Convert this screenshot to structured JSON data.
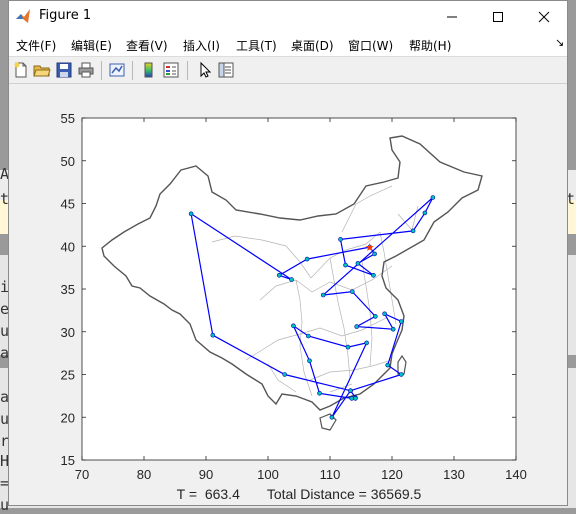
{
  "window": {
    "title": "Figure 1"
  },
  "menu": {
    "items": [
      "文件(F)",
      "编辑(E)",
      "查看(V)",
      "插入(I)",
      "工具(T)",
      "桌面(D)",
      "窗口(W)",
      "帮助(H)"
    ]
  },
  "background_text": [
    "AV",
    "ta",
    "i",
    "e",
    "u",
    "a",
    "a",
    "u",
    "r",
    "H",
    "=",
    "u",
    "tc"
  ],
  "plot": {
    "xlim": [
      70,
      140
    ],
    "ylim": [
      15,
      55
    ],
    "xticks": [
      "70",
      "80",
      "90",
      "100",
      "110",
      "120",
      "130",
      "140"
    ],
    "yticks": [
      "15",
      "20",
      "25",
      "30",
      "35",
      "40",
      "45",
      "50",
      "55"
    ],
    "route_color": "#0000ff",
    "node_color": "#00c0c0",
    "start_color": "#ff3300",
    "start": [
      116.4,
      39.9
    ],
    "route": [
      [
        116.4,
        39.9
      ],
      [
        117.2,
        39.1
      ],
      [
        114.5,
        38.0
      ],
      [
        117.0,
        36.6
      ],
      [
        112.5,
        37.8
      ],
      [
        111.7,
        40.8
      ],
      [
        123.4,
        41.8
      ],
      [
        125.3,
        43.9
      ],
      [
        126.6,
        45.7
      ],
      [
        108.9,
        34.3
      ],
      [
        113.6,
        34.7
      ],
      [
        117.3,
        31.8
      ],
      [
        114.3,
        30.6
      ],
      [
        120.2,
        30.3
      ],
      [
        118.8,
        32.1
      ],
      [
        121.5,
        31.2
      ],
      [
        119.3,
        26.1
      ],
      [
        121.5,
        25.0
      ],
      [
        113.3,
        23.1
      ],
      [
        114.1,
        22.3
      ],
      [
        114.1,
        22.2
      ],
      [
        113.5,
        22.2
      ],
      [
        108.3,
        22.8
      ],
      [
        106.7,
        26.6
      ],
      [
        104.1,
        30.7
      ],
      [
        106.5,
        29.5
      ],
      [
        112.9,
        28.2
      ],
      [
        115.9,
        28.7
      ],
      [
        110.3,
        20.0
      ],
      [
        113.3,
        23.1
      ],
      [
        102.7,
        25.0
      ],
      [
        91.1,
        29.6
      ],
      [
        87.6,
        43.8
      ],
      [
        103.8,
        36.1
      ],
      [
        101.8,
        36.6
      ],
      [
        106.3,
        38.5
      ],
      [
        116.4,
        39.9
      ]
    ],
    "status_text": "T =  663.4       Total Distance = 36569.5"
  }
}
